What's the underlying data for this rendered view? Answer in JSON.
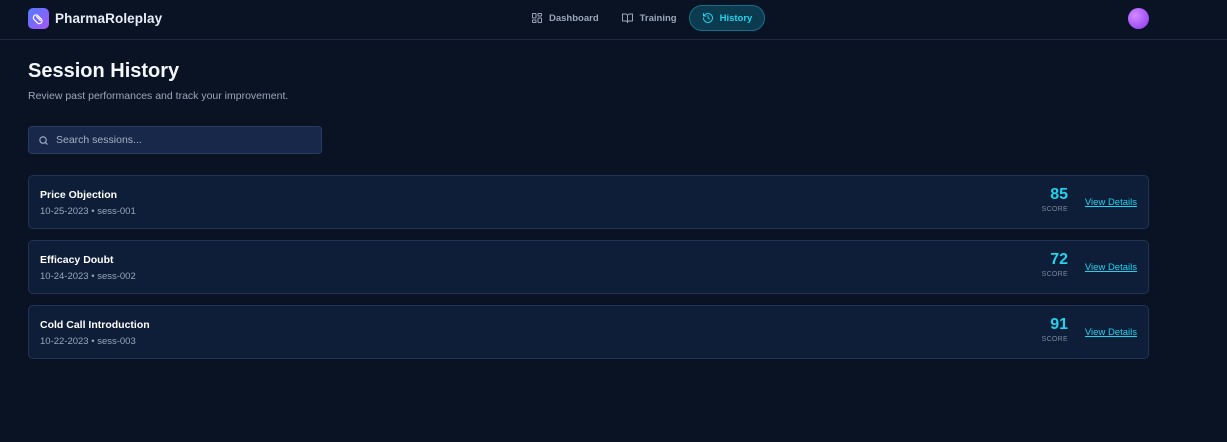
{
  "app": {
    "name": "PharmaRoleplay"
  },
  "nav": [
    {
      "label": "Dashboard",
      "icon": "grid-icon",
      "active": false
    },
    {
      "label": "Training",
      "icon": "book-open-icon",
      "active": false
    },
    {
      "label": "History",
      "icon": "history-icon",
      "active": true
    }
  ],
  "page": {
    "title": "Session History",
    "subtitle": "Review past performances and track your improvement."
  },
  "search": {
    "placeholder": "Search sessions...",
    "value": ""
  },
  "sessions": [
    {
      "title": "Price Objection",
      "meta": "10-25-2023 • sess-001",
      "score": "85",
      "score_label": "SCORE",
      "link": "View Details"
    },
    {
      "title": "Efficacy Doubt",
      "meta": "10-24-2023 • sess-002",
      "score": "72",
      "score_label": "SCORE",
      "link": "View Details"
    },
    {
      "title": "Cold Call Introduction",
      "meta": "10-22-2023 • sess-003",
      "score": "91",
      "score_label": "SCORE",
      "link": "View Details"
    }
  ],
  "colors": {
    "accent": "#22d3ee",
    "background": "#0a1324",
    "card": "#0e1d38",
    "avatar": "#a855f7"
  }
}
